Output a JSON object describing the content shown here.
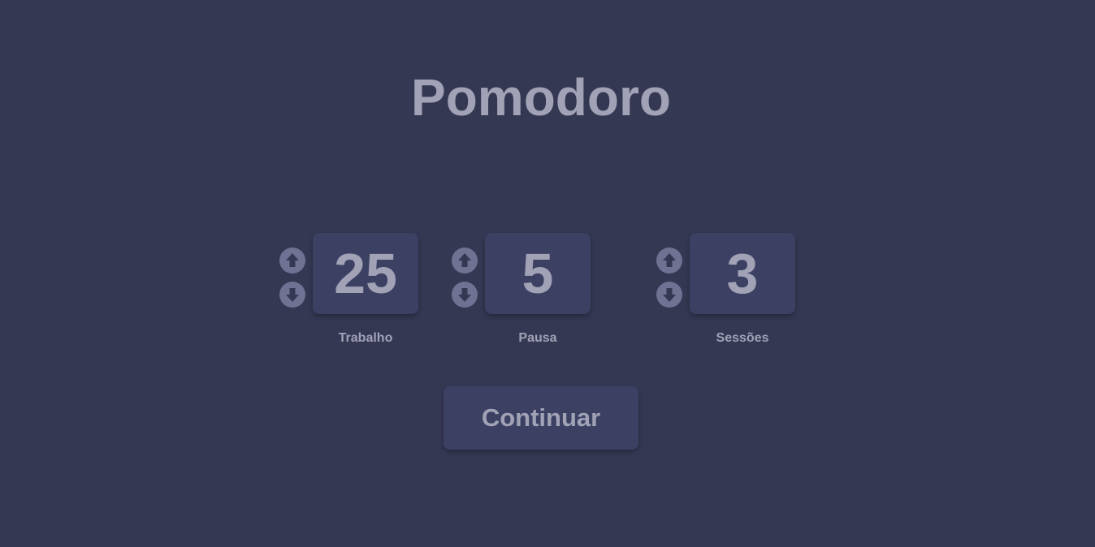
{
  "app": {
    "title": "Pomodoro"
  },
  "counters": [
    {
      "label": "Trabalho",
      "value": "25",
      "increase_icon": "arrow-up-circle-icon",
      "decrease_icon": "arrow-down-circle-icon"
    },
    {
      "label": "Pausa",
      "value": "5",
      "increase_icon": "arrow-up-circle-icon",
      "decrease_icon": "arrow-down-circle-icon"
    },
    {
      "label": "Sessões",
      "value": "3",
      "increase_icon": "arrow-up-circle-icon",
      "decrease_icon": "arrow-down-circle-icon"
    }
  ],
  "actions": {
    "continue_label": "Continuar"
  },
  "colors": {
    "background": "#353853",
    "card": "#3c4163",
    "text": "#a1a2b6",
    "arrow_circle": "#6f7293",
    "arrow_glyph": "#353853"
  }
}
